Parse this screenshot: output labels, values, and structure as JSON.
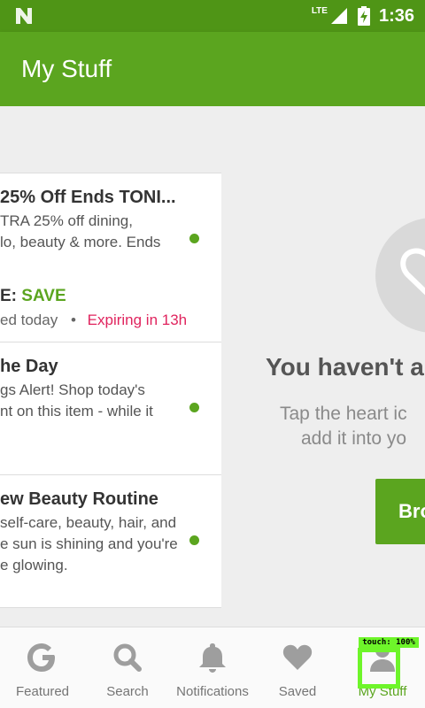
{
  "status_bar": {
    "network": "LTE",
    "time": "1:36"
  },
  "app_bar": {
    "title": "My Stuff"
  },
  "cards": [
    {
      "headline": "25% Off Ends TONI...",
      "body_lines": [
        "TRA 25% off dining,",
        "lo, beauty & more. Ends"
      ],
      "code_label": "E:",
      "code_value": "SAVE",
      "meta_left": "ed today",
      "meta_sep": "•",
      "meta_expiry": "Expiring in 13h"
    },
    {
      "headline": "he Day",
      "body_lines": [
        "gs Alert! Shop today's",
        "nt on this item - while it"
      ]
    },
    {
      "headline": "ew Beauty Routine",
      "body_lines": [
        "self-care, beauty, hair, and",
        "e sun is shining and you're",
        "e glowing."
      ]
    }
  ],
  "empty_state": {
    "heading": "You haven't ad",
    "sub_line1": "Tap the heart ic",
    "sub_line2": "add it into yo",
    "button": "Bro"
  },
  "bottom_nav": [
    {
      "label": "Featured",
      "icon": "g-logo-icon"
    },
    {
      "label": "Search",
      "icon": "search-icon"
    },
    {
      "label": "Notifications",
      "icon": "bell-icon"
    },
    {
      "label": "Saved",
      "icon": "heart-icon"
    },
    {
      "label": "My Stuff",
      "icon": "person-icon"
    }
  ],
  "overlay": {
    "touch_label": "touch: 100%"
  },
  "colors": {
    "status_bar": "#4f9516",
    "app_bar": "#5ba51f",
    "accent": "#5ba51f",
    "expiry": "#e0245e",
    "touch_highlight": "#6ef52a"
  }
}
